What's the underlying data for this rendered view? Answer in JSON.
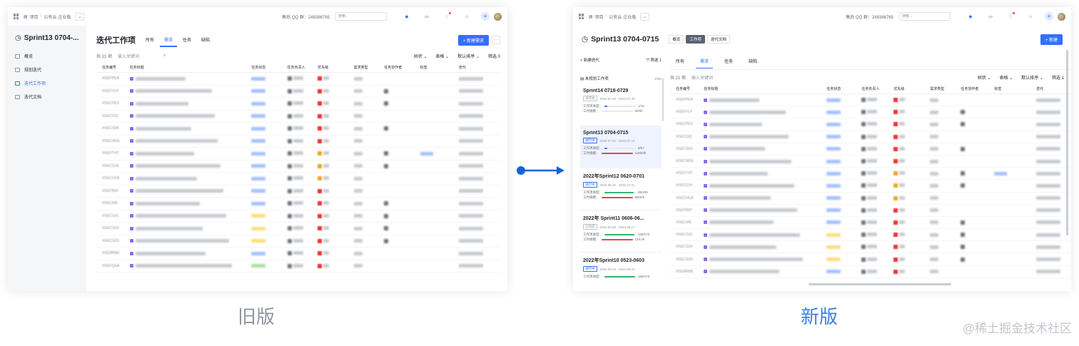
{
  "topbar": {
    "crumb_project": "项目",
    "crumb_workspace": "公有云·企业版",
    "qq_group": "售后 QQ 群：248386765",
    "search_placeholder": "搜索..."
  },
  "old": {
    "sidebar": {
      "title": "Sprint13 0704-...",
      "items": [
        {
          "label": "概览",
          "active": false
        },
        {
          "label": "规划迭代",
          "active": false
        },
        {
          "label": "迭代工作项",
          "active": true
        },
        {
          "label": "迭代文档",
          "active": false
        }
      ]
    },
    "page_title": "迭代工作项",
    "tabs": [
      "所有",
      "需求",
      "任务",
      "缺陷"
    ],
    "active_tab": 1,
    "new_button": "+ 新建需求",
    "count": "共 21 项",
    "keyword_placeholder": "输入关键词",
    "controls": [
      "树状",
      "表格",
      "默认排序",
      "筛选"
    ],
    "filter_count": "0",
    "columns": [
      "任务编号",
      "任务标题",
      "任务状态",
      "任务负责人",
      "优先级",
      "需求类型",
      "任务协作者",
      "标签",
      "迭代"
    ],
    "row_ids": [
      "#ISEFPEA",
      "#ISEFYLP",
      "#ISECPE3",
      "#ISECOIZ",
      "#ISECS5K",
      "#ISECM3S",
      "#ISEFTHT",
      "#ISECDJ4",
      "#ISECHU8",
      "#ISEFB8Y",
      "#ISECMK",
      "#ISECS41",
      "#ISECS3V",
      "#ISECS3D",
      "#ISEBRB8",
      "#ISEFQAA"
    ]
  },
  "new": {
    "title": "Sprint13 0704-0715",
    "view_tabs": [
      "概览",
      "工作项",
      "迭代文档"
    ],
    "active_view": 1,
    "new_button": "+ 新建",
    "new_sprint": "+ 新建迭代",
    "filter_label": "筛选",
    "filter_count": "1",
    "unplanned": "未规划工作项",
    "unplanned_count": "2068",
    "sprints": [
      {
        "title": "Sprint14 0718-0729",
        "status": "未开始",
        "dates": "2022.07.18 - 2022.07.30",
        "progress_label": "工作项进度：",
        "progress_text": "1/10",
        "progress": 0.1,
        "hours_label": "工时规模：",
        "hours_text": "0h/0h",
        "hours": 0,
        "hours_color": "#d0d3d6",
        "active": false
      },
      {
        "title": "Sprint13 0704-0715",
        "status": "进行中",
        "dates": "2022.07.04 - 2022.07.15",
        "progress_label": "工作项进度：",
        "progress_text": "5/57",
        "progress": 0.09,
        "hours_label": "工时规模：",
        "hours_text": "118h/0h",
        "hours": 1,
        "hours_color": "#e54a3c",
        "active": true
      },
      {
        "title": "2022年Sprint12 0620-0701",
        "status": "进行中",
        "dates": "2022.06.20 - 2022.07.01",
        "progress_label": "工作项进度：",
        "progress_text": "99/106",
        "progress": 0.93,
        "hours_label": "工时规模：",
        "hours_text": "56h/0h",
        "hours": 1,
        "hours_color": "#e54a3c",
        "active": false
      },
      {
        "title": "2022年 Sprint11 0606-06...",
        "status": "已完成",
        "dates": "2022.06.06 - 2022.06.17",
        "progress_label": "工作项进度：",
        "progress_text": "166/173",
        "progress": 0.96,
        "hours_label": "工时规模：",
        "hours_text": "126.0h",
        "hours": 1,
        "hours_color": "#e54a3c",
        "active": false
      },
      {
        "title": "2022年Sprint10 0523-0603",
        "status": "进行中",
        "dates": "2022.05.23 - 2022.06.03",
        "progress_label": "工作项进度：",
        "progress_text": "166/170",
        "progress": 0.97,
        "hours_label": "",
        "hours_text": "",
        "hours": 0,
        "hours_color": "#3370ff",
        "active": false
      }
    ],
    "tabs": [
      "所有",
      "需求",
      "任务",
      "缺陷"
    ],
    "active_tab": 1,
    "count": "共 21 项",
    "keyword_placeholder": "输入关键词",
    "controls": [
      "树状",
      "表格",
      "默认排序",
      "筛选"
    ],
    "filter_count2": "1",
    "columns": [
      "任务编号",
      "任务标题",
      "任务状态",
      "任务负责人",
      "优先级",
      "需求类型",
      "任务协作者",
      "标签",
      "迭代"
    ],
    "row_ids": [
      "#ISEFPEA",
      "#ISEFYLP",
      "#ISECPE3",
      "#ISECOIZ",
      "#ISECS5K",
      "#ISECM3S",
      "#ISEFTHT",
      "#ISECDJ4",
      "#ISECHU8",
      "#ISEFB8Y",
      "#ISECMK",
      "#ISECS41",
      "#ISECS3V",
      "#ISECS3D",
      "#ISEBRB8"
    ]
  },
  "captions": {
    "old": "旧版",
    "new": "新版"
  },
  "watermark": "@稀土掘金技术社区",
  "colors": {
    "accent": "#3370ff",
    "caption_new": "#3b7fde",
    "caption_old": "#8f959e"
  }
}
